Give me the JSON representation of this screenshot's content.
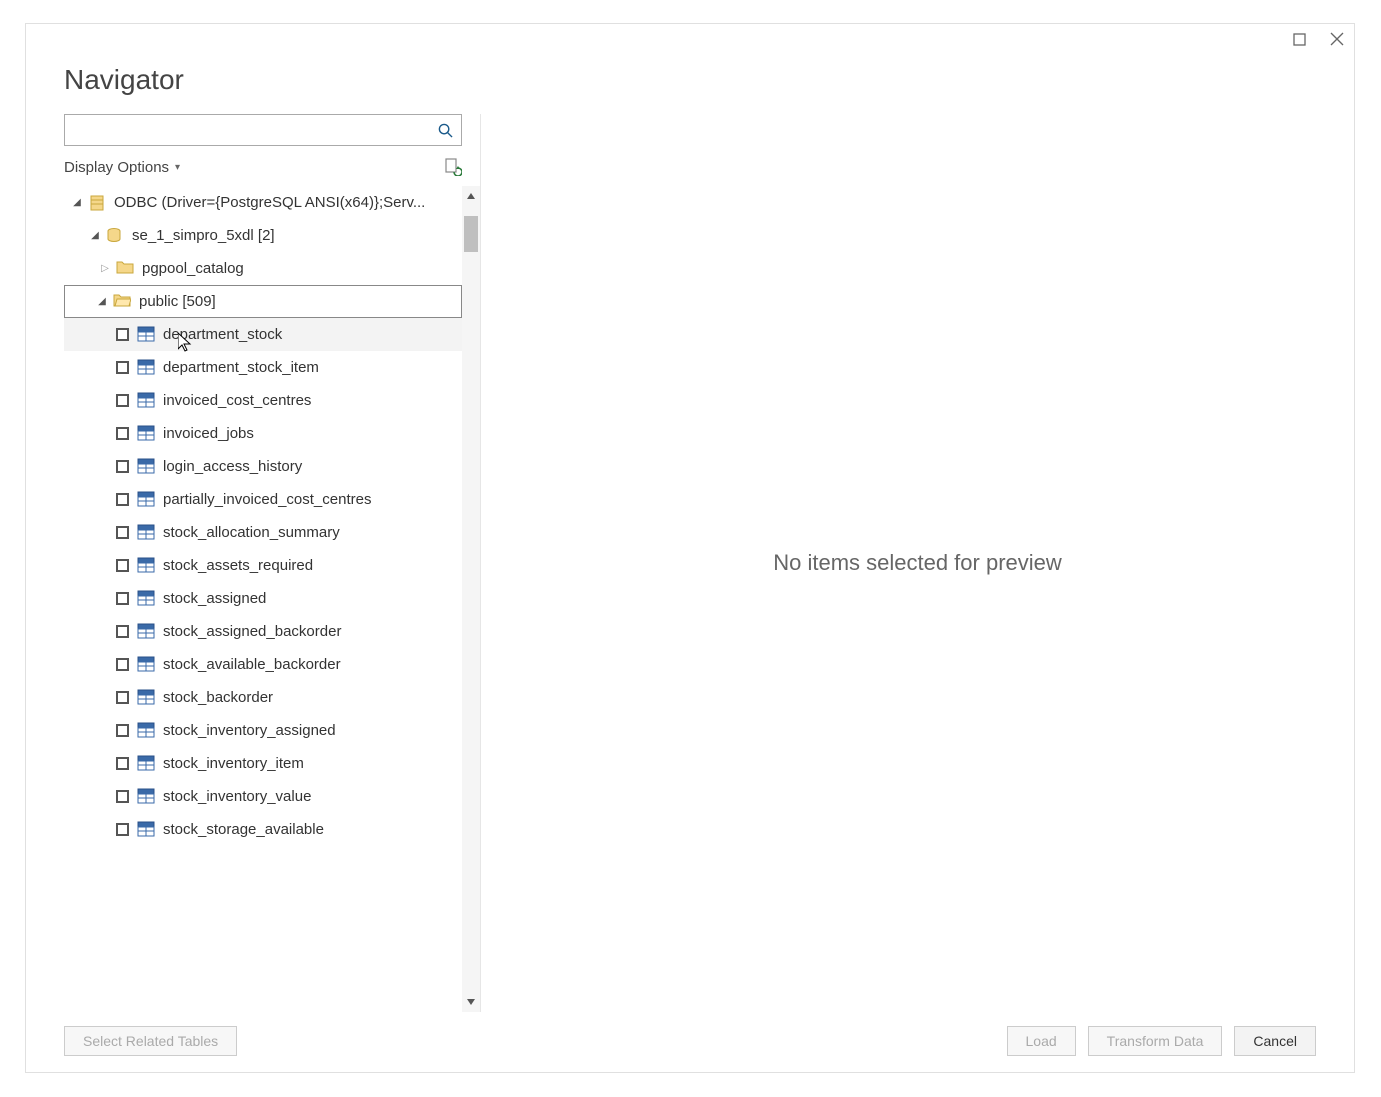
{
  "title": "Navigator",
  "search": {
    "placeholder": ""
  },
  "displayOptions": {
    "label": "Display Options"
  },
  "tree": {
    "root": {
      "label": "ODBC (Driver={PostgreSQL ANSI(x64)};Serv..."
    },
    "database": {
      "label": "se_1_simpro_5xdl [2]"
    },
    "schemas": [
      {
        "label": "pgpool_catalog",
        "expanded": false
      },
      {
        "label": "public [509]",
        "expanded": true,
        "selected": true
      }
    ],
    "tables": [
      {
        "label": "department_stock",
        "hover": true
      },
      {
        "label": "department_stock_item"
      },
      {
        "label": "invoiced_cost_centres"
      },
      {
        "label": "invoiced_jobs"
      },
      {
        "label": "login_access_history"
      },
      {
        "label": "partially_invoiced_cost_centres"
      },
      {
        "label": "stock_allocation_summary"
      },
      {
        "label": "stock_assets_required"
      },
      {
        "label": "stock_assigned"
      },
      {
        "label": "stock_assigned_backorder"
      },
      {
        "label": "stock_available_backorder"
      },
      {
        "label": "stock_backorder"
      },
      {
        "label": "stock_inventory_assigned"
      },
      {
        "label": "stock_inventory_item"
      },
      {
        "label": "stock_inventory_value"
      },
      {
        "label": "stock_storage_available"
      }
    ]
  },
  "preview": {
    "empty": "No items selected for preview"
  },
  "buttons": {
    "selectRelated": "Select Related Tables",
    "load": "Load",
    "transform": "Transform Data",
    "cancel": "Cancel"
  }
}
